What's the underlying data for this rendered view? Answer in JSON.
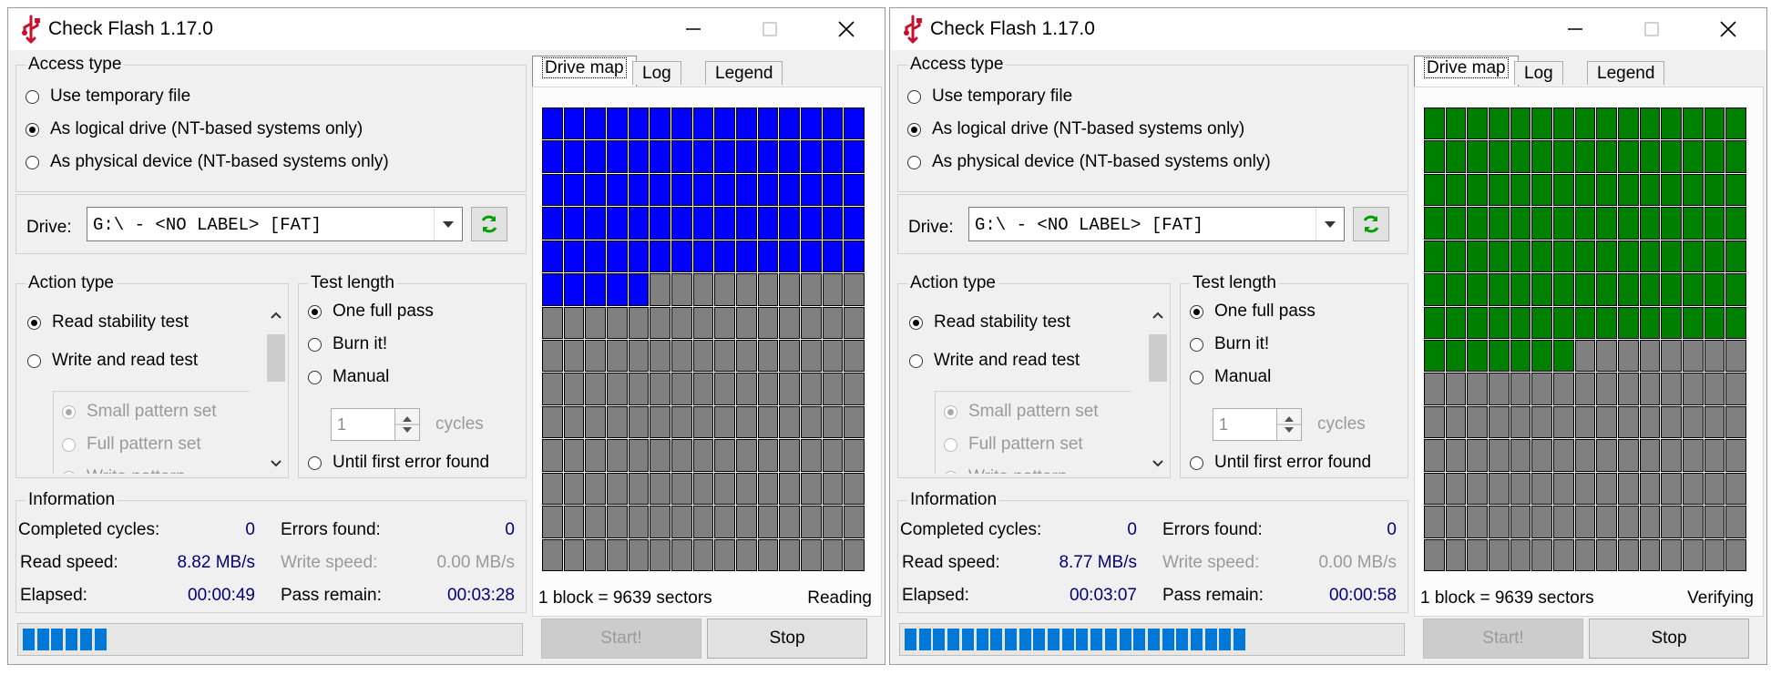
{
  "colors": {
    "blue_block": "#0000ff",
    "green_block": "#008000",
    "gray_block": "#808080",
    "progress": "#0078d7",
    "info_value": "#00007c"
  },
  "windows": [
    {
      "title": "Check Flash 1.17.0",
      "access_type": {
        "legend": "Access type",
        "options": [
          "Use temporary file",
          "As logical drive (NT-based systems only)",
          "As physical device (NT-based systems only)"
        ],
        "selected": 1
      },
      "drive": {
        "label": "Drive:",
        "value": "G:\\ - <NO LABEL> [FAT]"
      },
      "action_type": {
        "legend": "Action type",
        "options": [
          "Read stability test",
          "Write and read test"
        ],
        "sub_options": [
          "Small pattern set",
          "Full pattern set",
          "Write pattern"
        ],
        "selected": 0
      },
      "test_length": {
        "legend": "Test length",
        "options": [
          "One full pass",
          "Burn it!",
          "Manual",
          "Until first error found"
        ],
        "selected": 0,
        "cycles_value": "1",
        "cycles_label": "cycles"
      },
      "information": {
        "legend": "Information",
        "completed_cycles_label": "Completed cycles:",
        "completed_cycles": "0",
        "errors_found_label": "Errors found:",
        "errors_found": "0",
        "read_speed_label": "Read speed:",
        "read_speed": "8.82 MB/s",
        "write_speed_label": "Write speed:",
        "write_speed": "0.00 MB/s",
        "elapsed_label": "Elapsed:",
        "elapsed": "00:00:49",
        "pass_remain_label": "Pass remain:",
        "pass_remain": "00:03:28"
      },
      "progress_segments": 6,
      "tabs": [
        "Drive map",
        "Log",
        "Legend"
      ],
      "active_tab": 0,
      "drive_map": {
        "columns": 15,
        "rows": 14,
        "filled_blocks": 80,
        "filled_color": "#0000ff"
      },
      "block_info": "1 block = 9639 sectors",
      "status": "Reading",
      "buttons": {
        "start": "Start!",
        "stop": "Stop"
      }
    },
    {
      "title": "Check Flash 1.17.0",
      "access_type": {
        "legend": "Access type",
        "options": [
          "Use temporary file",
          "As logical drive (NT-based systems only)",
          "As physical device (NT-based systems only)"
        ],
        "selected": 1
      },
      "drive": {
        "label": "Drive:",
        "value": "G:\\ - <NO LABEL> [FAT]"
      },
      "action_type": {
        "legend": "Action type",
        "options": [
          "Read stability test",
          "Write and read test"
        ],
        "sub_options": [
          "Small pattern set",
          "Full pattern set",
          "Write pattern"
        ],
        "selected": 0
      },
      "test_length": {
        "legend": "Test length",
        "options": [
          "One full pass",
          "Burn it!",
          "Manual",
          "Until first error found"
        ],
        "selected": 0,
        "cycles_value": "1",
        "cycles_label": "cycles"
      },
      "information": {
        "legend": "Information",
        "completed_cycles_label": "Completed cycles:",
        "completed_cycles": "0",
        "errors_found_label": "Errors found:",
        "errors_found": "0",
        "read_speed_label": "Read speed:",
        "read_speed": "8.77 MB/s",
        "write_speed_label": "Write speed:",
        "write_speed": "0.00 MB/s",
        "elapsed_label": "Elapsed:",
        "elapsed": "00:03:07",
        "pass_remain_label": "Pass remain:",
        "pass_remain": "00:00:58"
      },
      "progress_segments": 24,
      "tabs": [
        "Drive map",
        "Log",
        "Legend"
      ],
      "active_tab": 0,
      "drive_map": {
        "columns": 15,
        "rows": 14,
        "filled_blocks": 112,
        "filled_color": "#008000"
      },
      "block_info": "1 block = 9639 sectors",
      "status": "Verifying",
      "buttons": {
        "start": "Start!",
        "stop": "Stop"
      }
    }
  ]
}
